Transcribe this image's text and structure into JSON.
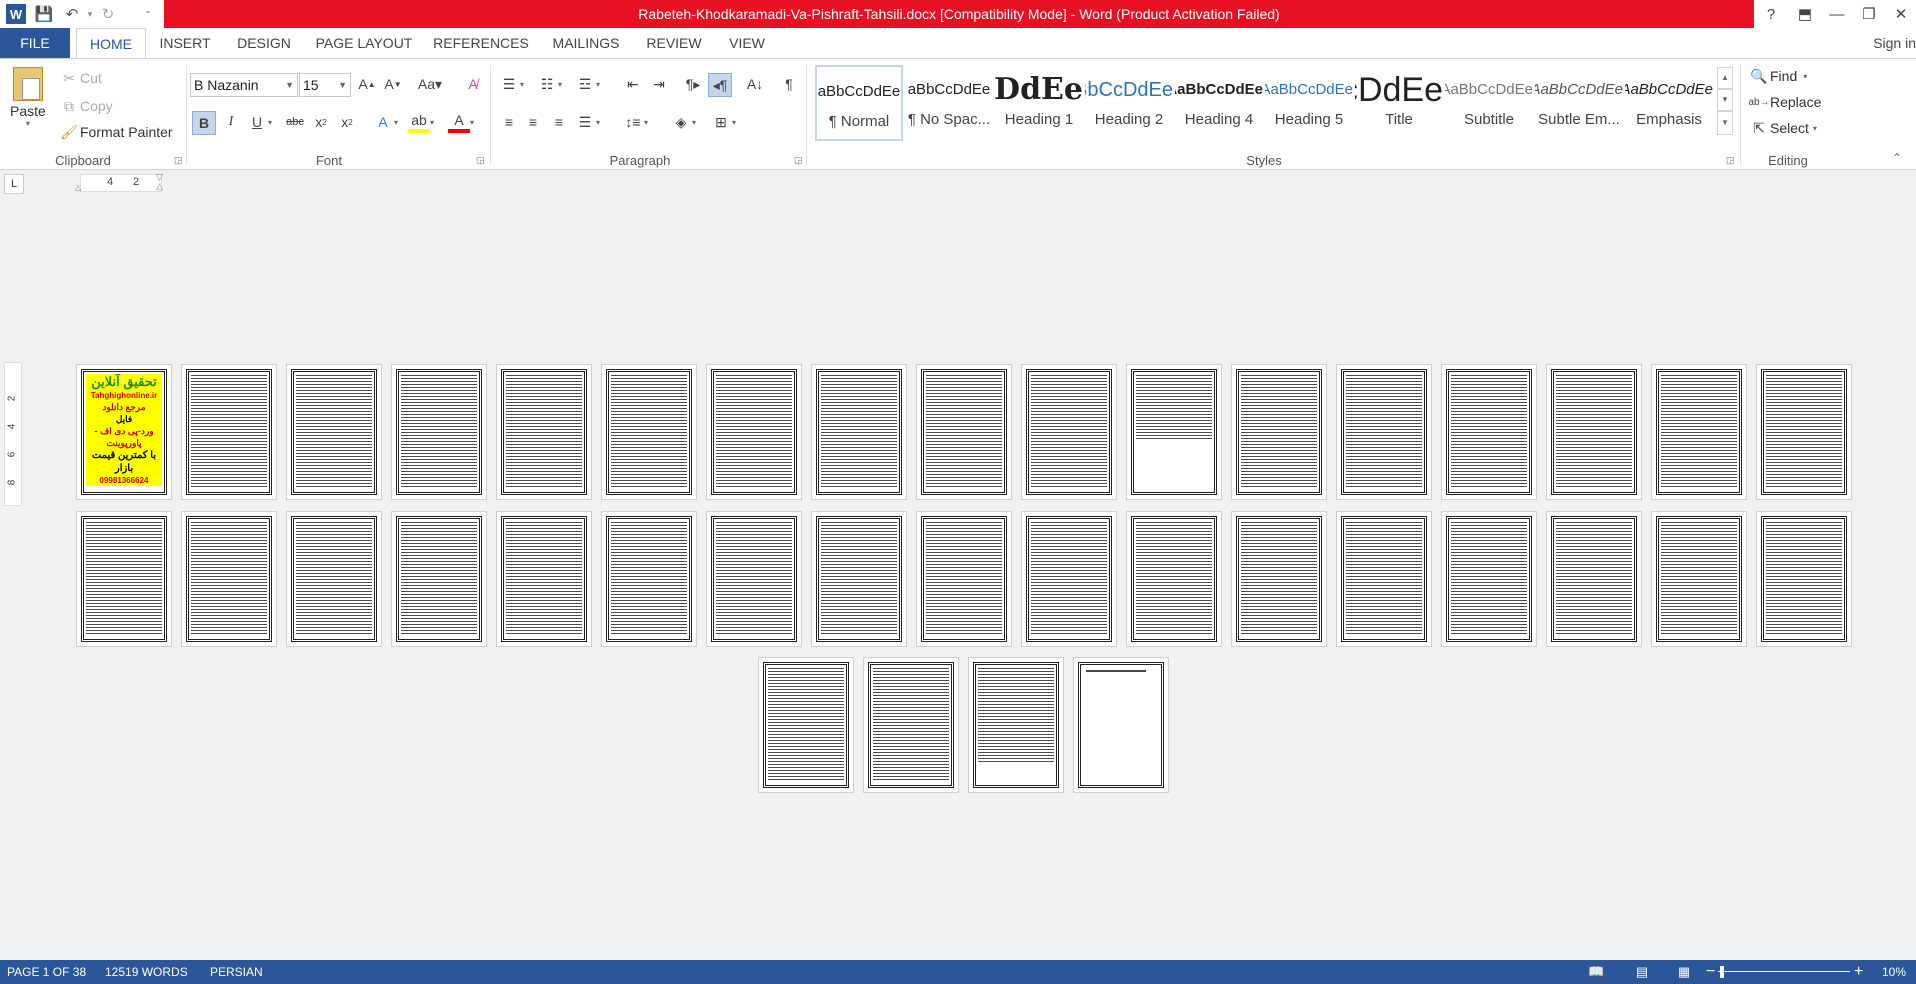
{
  "window": {
    "title": "Rabeteh-Khodkaramadi-Va-Pishraft-Tahsili.docx [Compatibility Mode] -  Word (Product Activation Failed)",
    "help": "?",
    "controls": {
      "restore_ribbon": "⬒",
      "minimize": "—",
      "maximize": "❐",
      "close": "✕"
    }
  },
  "qat": {
    "word_icon": "W",
    "save": "💾",
    "undo": "↶",
    "redo": "↻",
    "customize": "⁼"
  },
  "tabs": {
    "file": "FILE",
    "home": "HOME",
    "insert": "INSERT",
    "design": "DESIGN",
    "page_layout": "PAGE LAYOUT",
    "references": "REFERENCES",
    "mailings": "MAILINGS",
    "review": "REVIEW",
    "view": "VIEW",
    "sign_in": "Sign in"
  },
  "clipboard": {
    "paste": "Paste",
    "cut": "Cut",
    "copy": "Copy",
    "format_painter": "Format Painter",
    "label": "Clipboard"
  },
  "font": {
    "name": "B Nazanin",
    "size": "15",
    "label": "Font"
  },
  "paragraph": {
    "label": "Paragraph"
  },
  "styles": {
    "label": "Styles",
    "items": [
      {
        "preview": "aBbCcDdEe",
        "name": "¶ Normal"
      },
      {
        "preview": "aBbCcDdEe",
        "name": "¶ No Spac..."
      },
      {
        "preview": "AaBbCcDdEe",
        "name": "Heading 1"
      },
      {
        "preview": "AaBbCcDdEe",
        "name": "Heading 2"
      },
      {
        "preview": "AaBbCcDdEe",
        "name": "Heading 4"
      },
      {
        "preview": "AaBbCcDdEe",
        "name": "Heading 5"
      },
      {
        "preview": "AaBbCcDdEe",
        "name": "Title"
      },
      {
        "preview": "AaBbCcDdEe",
        "name": "Subtitle"
      },
      {
        "preview": "AaBbCcDdEe",
        "name": "Subtle Em..."
      },
      {
        "preview": "AaBbCcDdEe",
        "name": "Emphasis"
      }
    ]
  },
  "editing": {
    "find": "Find",
    "replace": "Replace",
    "select": "Select",
    "label": "Editing"
  },
  "ruler": {
    "tab_selector": "L",
    "marks": [
      "4",
      "2"
    ],
    "vertical_marks": [
      "2",
      "4",
      "6",
      "8"
    ]
  },
  "cover_page": {
    "line1": "تحقیق آنلاین",
    "line2": "Tahghighonline.ir",
    "line3": "مرجع دانلود",
    "line4": "فایل",
    "line5": "ورد-پی دی اف - پاورپوینت",
    "line6": "با کمترین قیمت بازار",
    "line7": "09981366624 واتساپ"
  },
  "status": {
    "page": "PAGE 1 OF 38",
    "words": "12519 WORDS",
    "language": "PERSIAN",
    "zoom": "10%",
    "zoom_out": "−",
    "zoom_in": "+",
    "zoom_level": 0.1
  },
  "colors": {
    "accent": "#2b579a",
    "title_bar": "#e81123",
    "highlight": "#ffff00",
    "font_color": "#ff0000"
  }
}
